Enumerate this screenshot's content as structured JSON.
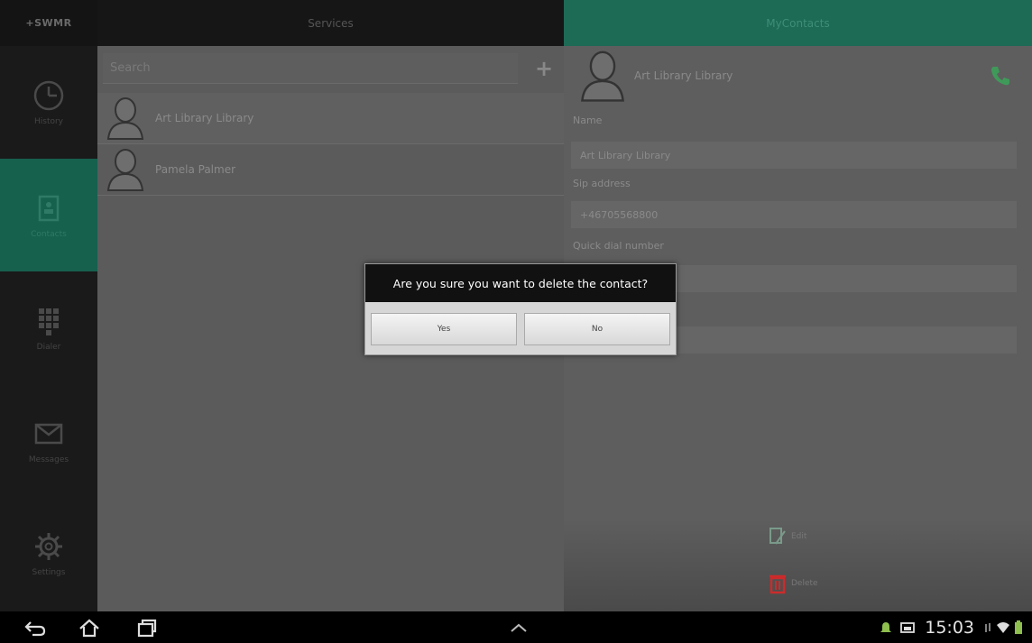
{
  "app": {
    "brand": "+SWMR"
  },
  "tabs": [
    {
      "label": "Services"
    },
    {
      "label": "MyContacts"
    }
  ],
  "sidebar": {
    "items": [
      {
        "label": "History",
        "icon": "clock-icon"
      },
      {
        "label": "Contacts",
        "icon": "contacts-icon"
      },
      {
        "label": "Dialer",
        "icon": "dialpad-icon"
      },
      {
        "label": "Messages",
        "icon": "envelope-icon"
      },
      {
        "label": "Settings",
        "icon": "gear-icon"
      }
    ]
  },
  "list": {
    "search_placeholder": "Search",
    "add_label": "+",
    "contacts": [
      {
        "name": "Art Library Library"
      },
      {
        "name": "Pamela Palmer"
      }
    ]
  },
  "detail": {
    "name": "Art Library Library",
    "fields": [
      {
        "label": "Name",
        "value": "Art Library Library"
      },
      {
        "label": "Sip address",
        "value": "+46705568800"
      },
      {
        "label": "Quick dial number",
        "value": ""
      },
      {
        "label": "",
        "value": ""
      }
    ],
    "actions": {
      "edit_label": "Edit",
      "delete_label": "Delete"
    }
  },
  "dialog": {
    "title": "Are you sure you want to delete the contact?",
    "yes_label": "Yes",
    "no_label": "No"
  },
  "status_bar": {
    "time": "15:03"
  },
  "colors": {
    "accent": "#1d6a55",
    "delete": "#cc2b2b",
    "call": "#3f9a5a"
  }
}
